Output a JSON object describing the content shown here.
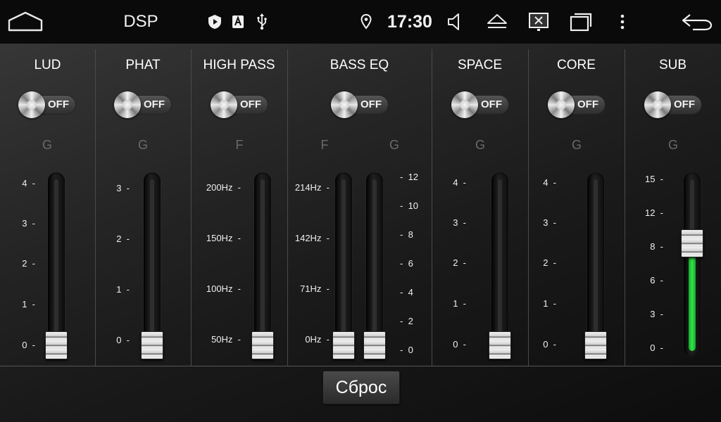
{
  "status_bar": {
    "title": "DSP",
    "time": "17:30",
    "icons": [
      "home-icon",
      "shield-play-icon",
      "a-box-icon",
      "usb-icon",
      "location-pin-icon",
      "volume-icon",
      "eject-icon",
      "screen-off-icon",
      "recent-windows-icon",
      "more-icon",
      "back-icon"
    ]
  },
  "panels": [
    {
      "title": "LUD",
      "toggle": "OFF",
      "unit": "G",
      "ticks": [
        "4",
        "3",
        "2",
        "1",
        "0"
      ],
      "value": 0
    },
    {
      "title": "PHAT",
      "toggle": "OFF",
      "unit": "G",
      "ticks": [
        "3",
        "2",
        "1",
        "0"
      ],
      "value": 0
    },
    {
      "title": "HIGH PASS",
      "toggle": "OFF",
      "unit": "F",
      "ticks": [
        "200Hz",
        "150Hz",
        "100Hz",
        "50Hz"
      ],
      "value": "50Hz"
    },
    {
      "title": "BASS EQ",
      "toggle": "OFF",
      "unit_f": "F",
      "unit_g": "G",
      "ticks_f": [
        "214Hz",
        "142Hz",
        "71Hz",
        "0Hz"
      ],
      "ticks_g": [
        "12",
        "10",
        "8",
        "6",
        "4",
        "2",
        "0"
      ],
      "value_f": "0Hz",
      "value_g": 0
    },
    {
      "title": "SPACE",
      "toggle": "OFF",
      "unit": "G",
      "ticks": [
        "4",
        "3",
        "2",
        "1",
        "0"
      ],
      "value": 0
    },
    {
      "title": "CORE",
      "toggle": "OFF",
      "unit": "G",
      "ticks": [
        "4",
        "3",
        "2",
        "1",
        "0"
      ],
      "value": 0
    },
    {
      "title": "SUB",
      "toggle": "OFF",
      "unit": "G",
      "ticks": [
        "15",
        "12",
        "8",
        "6",
        "3",
        "0"
      ],
      "value": 8
    }
  ],
  "reset_label": "Сброс",
  "colors": {
    "accent_green": "#2ee846",
    "background": "#1a1a1a",
    "status_bar": "#0a0a0a"
  }
}
